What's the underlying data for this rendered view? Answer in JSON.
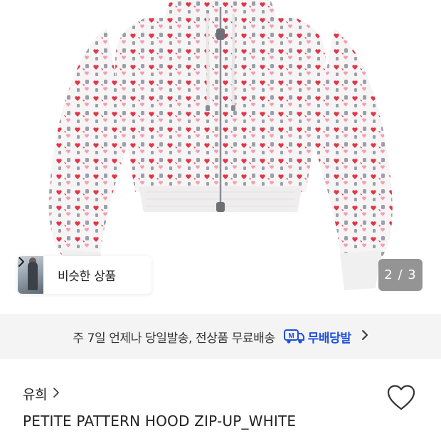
{
  "product_image": {
    "alt_icon": "hoodie-product-photo",
    "similar_products": {
      "label": "비슷한 상품",
      "arrow_icon": "chevron-right-icon"
    },
    "counter": {
      "current": "2",
      "separator": "/",
      "total": "3",
      "text": "2 / 3"
    }
  },
  "shipping_banner": {
    "text": "주 7일 언제나 당일발송, 전상품 무료배송",
    "logo_icon": "m-delivery-truck-icon",
    "brand": "무배당발",
    "arrow_icon": "chevron-right-icon",
    "brand_color": "#1f4fe0"
  },
  "product": {
    "brand": "유희",
    "brand_arrow_icon": "chevron-right-icon",
    "title": "PETITE PATTERN HOOD ZIP-UP_WHITE",
    "like_icon": "heart-outline-icon"
  },
  "colors": {
    "print_red": "#e0384a",
    "print_pink": "#f0a0b2",
    "print_grey": "#9aa0a8"
  }
}
